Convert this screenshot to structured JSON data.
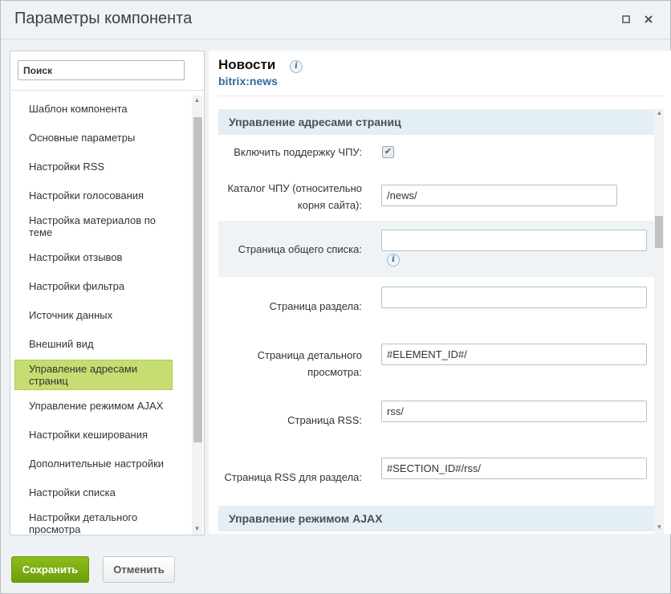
{
  "window": {
    "title": "Параметры компонента"
  },
  "search": {
    "placeholder": "Поиск"
  },
  "sidebar": {
    "items": [
      {
        "label": "Шаблон компонента"
      },
      {
        "label": "Основные параметры"
      },
      {
        "label": "Настройки RSS"
      },
      {
        "label": "Настройки голосования"
      },
      {
        "label": "Настройка материалов по теме"
      },
      {
        "label": "Настройки отзывов"
      },
      {
        "label": "Настройки фильтра"
      },
      {
        "label": "Источник данных"
      },
      {
        "label": "Внешний вид"
      },
      {
        "label": "Управление адресами страниц"
      },
      {
        "label": "Управление режимом AJAX"
      },
      {
        "label": "Настройки кеширования"
      },
      {
        "label": "Дополнительные настройки"
      },
      {
        "label": "Настройки списка"
      },
      {
        "label": "Настройки детального просмотра"
      }
    ]
  },
  "component": {
    "name": "Новости",
    "code": "bitrix:news"
  },
  "section": {
    "title": "Управление адресами страниц"
  },
  "fields": {
    "sef_mode_label": "Включить поддержку ЧПУ:",
    "sef_folder_label": "Каталог ЧПУ (относительно корня сайта):",
    "sef_folder_value": "/news/",
    "list_page_label": "Страница общего списка:",
    "list_page_value": "",
    "section_page_label": "Страница раздела:",
    "section_page_value": "",
    "detail_page_label": "Страница детального просмотра:",
    "detail_page_value": "#ELEMENT_ID#/",
    "rss_page_label": "Страница RSS:",
    "rss_page_value": "rss/",
    "rss_section_label": "Страница RSS для раздела:",
    "rss_section_value": "#SECTION_ID#/rss/"
  },
  "next_section": {
    "title": "Управление режимом AJAX"
  },
  "buttons": {
    "save": "Сохранить",
    "cancel": "Отменить"
  }
}
